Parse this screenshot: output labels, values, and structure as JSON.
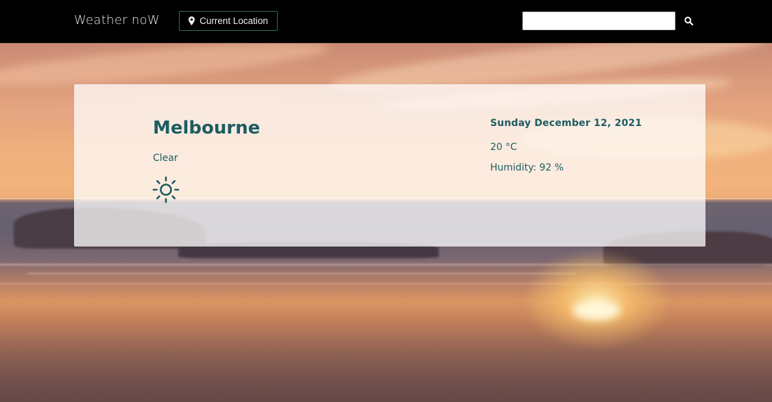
{
  "navbar": {
    "brand": "Weather noW",
    "location_button": "Current Location",
    "search_placeholder": "",
    "search_value": ""
  },
  "weather": {
    "city": "Melbourne",
    "condition": "Clear",
    "condition_icon": "sun-icon",
    "date": "Sunday December 12, 2021",
    "temperature": "20 °C",
    "humidity": "Humidity: 92 %"
  },
  "colors": {
    "accent": "#1c5c62",
    "navbar_bg": "#000000",
    "button_border": "#2f6b6b"
  }
}
